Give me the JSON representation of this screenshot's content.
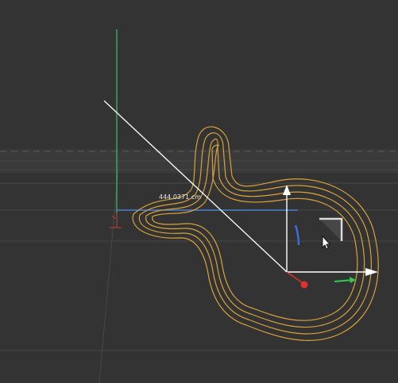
{
  "viewport": {
    "background_color": "#333333",
    "measurement_label": "444.0371 cm",
    "colors": {
      "curve": "#d9a23a",
      "x_axis": "#4a7fd0",
      "y_axis": "#3fbf6a",
      "gizmo": "#ffffff",
      "gizmo_red": "#e03030",
      "gizmo_green": "#2ecc55",
      "gizmo_blue": "#3a6fd8"
    }
  }
}
